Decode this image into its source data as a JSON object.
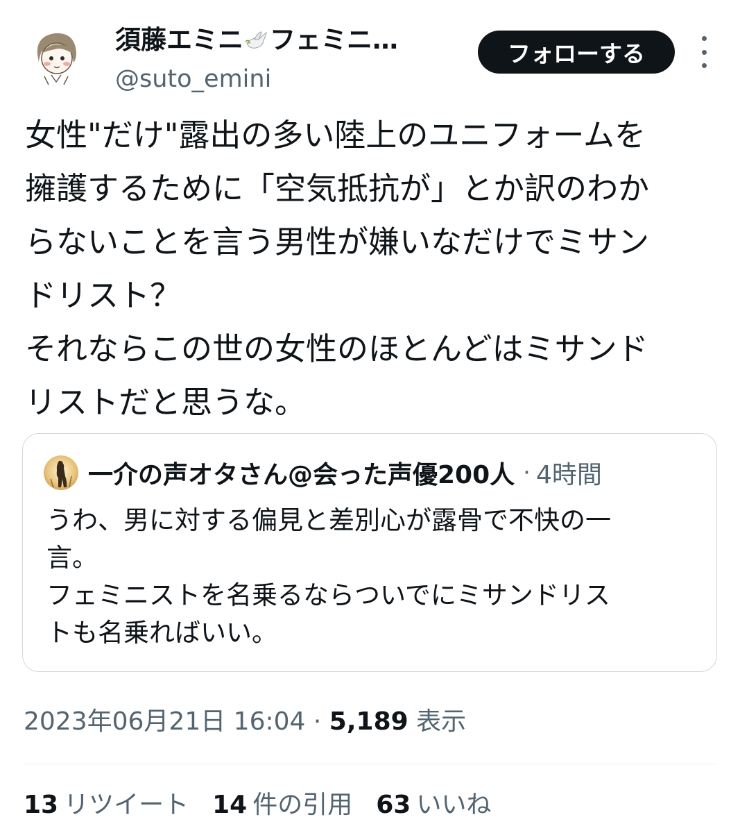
{
  "author": {
    "display_name": "須藤エミニ",
    "display_name_suffix": "フェミニ…",
    "handle": "@suto_emini",
    "avatar_icon": "girl-avatar-icon",
    "dove_icon": "dove-icon"
  },
  "follow_button": {
    "label": "フォローする"
  },
  "more_icon": "more-vertical-icon",
  "tweet": {
    "lines": [
      "女性\"だけ\"露出の多い陸上のユニフォームを",
      "擁護するために「空気抵抗が」とか訳のわか",
      "らないことを言う男性が嫌いなだけでミサン",
      "ドリスト？",
      "それならこの世の女性のほとんどはミサンド",
      "リストだと思うな。"
    ]
  },
  "quote": {
    "name": "一介の声オタさん@会った声優200人",
    "separator": "·",
    "time": "4時間",
    "lines": [
      "うわ、男に対する偏見と差別心が露骨で不快の一",
      "言。",
      "フェミニストを名乗るならついでにミサンドリス",
      "トも名乗ればいい。"
    ]
  },
  "meta": {
    "datetime": "2023年06月21日 16:04",
    "separator": "·",
    "views": "5,189",
    "views_label": "表示"
  },
  "stats": {
    "retweets": {
      "num": "13",
      "label": "リツイート"
    },
    "quotes": {
      "num": "14",
      "label": "件の引用"
    },
    "likes": {
      "num": "63",
      "label": "いいね"
    }
  },
  "colors": {
    "text": "#0f1419",
    "secondary": "#536471",
    "border": "#cfd9de",
    "button": "#0f1419"
  }
}
